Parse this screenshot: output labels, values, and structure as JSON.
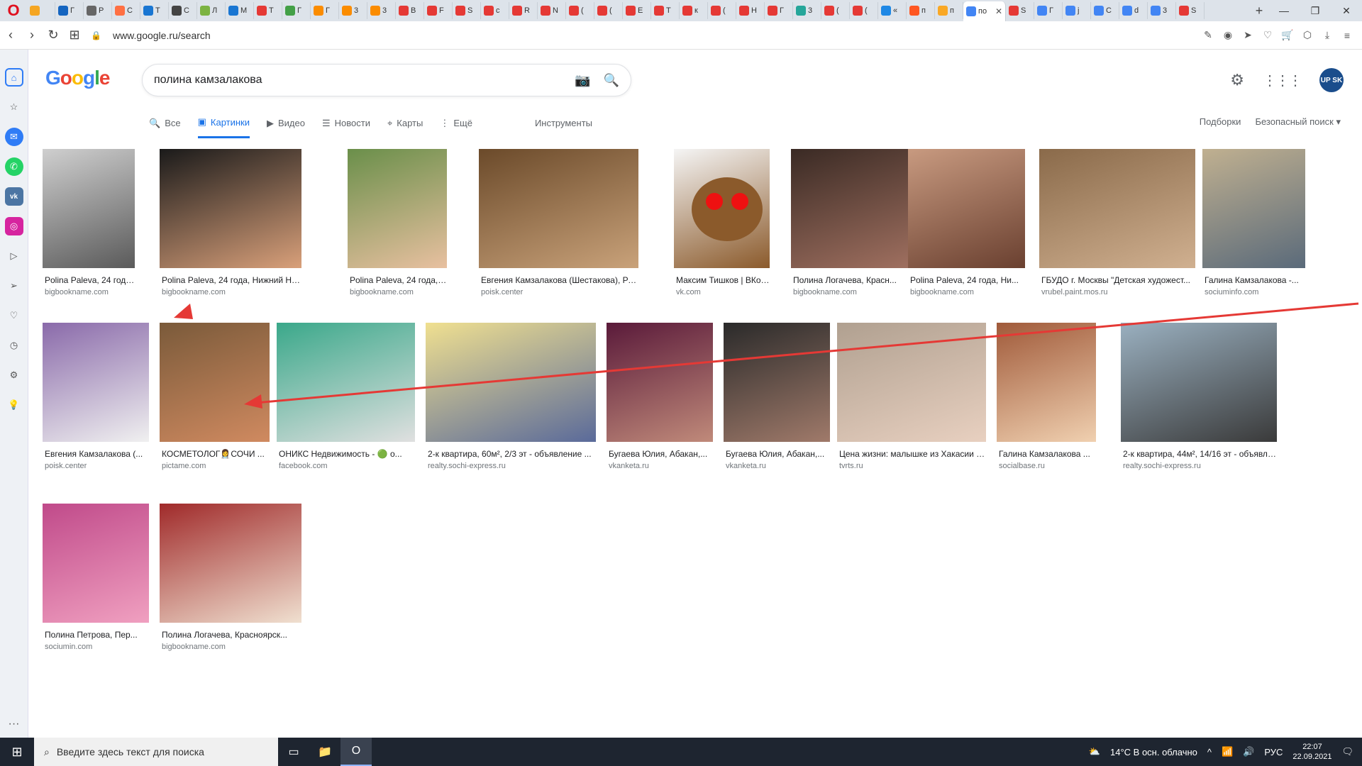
{
  "browser": {
    "opera_logo": "O",
    "tabs": [
      {
        "label": "",
        "color": "#f5a623"
      },
      {
        "label": "Г",
        "color": "#1565c0"
      },
      {
        "label": "Р",
        "color": "#666666"
      },
      {
        "label": "С",
        "color": "#ff7043"
      },
      {
        "label": "Т",
        "color": "#1976d2"
      },
      {
        "label": "С",
        "color": "#444444"
      },
      {
        "label": "Л",
        "color": "#7cb342"
      },
      {
        "label": "М",
        "color": "#1976d2"
      },
      {
        "label": "Т",
        "color": "#e53935"
      },
      {
        "label": "Г",
        "color": "#43a047"
      },
      {
        "label": "Г",
        "color": "#fb8c00"
      },
      {
        "label": "3",
        "color": "#fb8c00"
      },
      {
        "label": "3",
        "color": "#fb8c00"
      },
      {
        "label": "В",
        "color": "#e53935"
      },
      {
        "label": "F",
        "color": "#e53935"
      },
      {
        "label": "S",
        "color": "#e53935"
      },
      {
        "label": "с",
        "color": "#e53935"
      },
      {
        "label": "R",
        "color": "#e53935"
      },
      {
        "label": "N",
        "color": "#e53935"
      },
      {
        "label": "(",
        "color": "#e53935"
      },
      {
        "label": "(",
        "color": "#e53935"
      },
      {
        "label": "Е",
        "color": "#e53935"
      },
      {
        "label": "Т",
        "color": "#e53935"
      },
      {
        "label": "к",
        "color": "#e53935"
      },
      {
        "label": "(",
        "color": "#e53935"
      },
      {
        "label": "Н",
        "color": "#e53935"
      },
      {
        "label": "Г",
        "color": "#e53935"
      },
      {
        "label": "3",
        "color": "#26a69a"
      },
      {
        "label": "(",
        "color": "#e53935"
      },
      {
        "label": "(",
        "color": "#e53935"
      },
      {
        "label": "«",
        "color": "#1e88e5"
      },
      {
        "label": "п",
        "color": "#ff5722"
      },
      {
        "label": "п",
        "color": "#f9a825"
      },
      {
        "label": "по",
        "color": "#4285f4",
        "active": true
      },
      {
        "label": "S",
        "color": "#e53935"
      },
      {
        "label": "Г",
        "color": "#4285f4"
      },
      {
        "label": "j",
        "color": "#4285f4"
      },
      {
        "label": "С",
        "color": "#4285f4"
      },
      {
        "label": "d",
        "color": "#4285f4"
      },
      {
        "label": "3",
        "color": "#4285f4"
      },
      {
        "label": "S",
        "color": "#e53935"
      }
    ],
    "tab_close": "✕",
    "new_tab": "+",
    "url": "www.google.ru/search",
    "win_min": "—",
    "win_max": "❐",
    "win_close": "✕"
  },
  "search": {
    "query": "полина камзалакова",
    "tabs": [
      {
        "label": "Все",
        "icon": "🔍"
      },
      {
        "label": "Картинки",
        "icon": "▣",
        "active": true
      },
      {
        "label": "Видео",
        "icon": "▶"
      },
      {
        "label": "Новости",
        "icon": "☰"
      },
      {
        "label": "Карты",
        "icon": "⌖"
      },
      {
        "label": "Ещё",
        "icon": "⋮"
      }
    ],
    "tools": "Инструменты",
    "collections": "Подборки",
    "safe_search": "Безопасный поиск ▾",
    "avatar_text": "UP SK"
  },
  "results": [
    {
      "caption": "Polina Paleva, 24 года, ...",
      "source": "bigbookname.com",
      "colors": [
        "#cfcfcf",
        "#5a5a5a"
      ]
    },
    {
      "caption": "Polina Paleva, 24 года, Нижний Новго...",
      "source": "bigbookname.com",
      "colors": [
        "#1a1a1a",
        "#d9a07a"
      ]
    },
    {
      "caption": "Polina Paleva, 24 года, ...",
      "source": "bigbookname.com",
      "colors": [
        "#6a8f4a",
        "#e8c0a0"
      ]
    },
    {
      "caption": "Евгения Камзалакова (Шестакова), Россия,...",
      "source": "poisk.center",
      "colors": [
        "#6b4a2a",
        "#c9a27a"
      ]
    },
    {
      "caption": "Максим Тишков | ВКонта...",
      "source": "vk.com",
      "colors": [
        "#f5f5f5",
        "#8b5a2b"
      ]
    },
    {
      "caption": "Полина Логачева, Красн...",
      "source": "bigbookname.com",
      "colors": [
        "#3a2a24",
        "#a07060"
      ]
    },
    {
      "caption": "Polina Paleva, 24 года, Ни...",
      "source": "bigbookname.com",
      "colors": [
        "#c89a80",
        "#6a4030"
      ]
    },
    {
      "caption": "ГБУДО г. Москвы \"Детская художест...",
      "source": "vrubel.paint.mos.ru",
      "colors": [
        "#8a6a4a",
        "#d0b090"
      ]
    },
    {
      "caption": "Галина Камзалакова -...",
      "source": "sociuminfo.com",
      "colors": [
        "#c0b090",
        "#5a6a7a"
      ]
    },
    {
      "caption": "Евгения Камзалакова (...",
      "source": "poisk.center",
      "colors": [
        "#8a6aaa",
        "#f0f0f0"
      ]
    },
    {
      "caption": "КОСМЕТОЛОГ👩‍⚕️СОЧИ ...",
      "source": "pictame.com",
      "colors": [
        "#7a5a3a",
        "#d08a60"
      ]
    },
    {
      "caption": "ОНИКС Недвижимость - 🟢 о...",
      "source": "facebook.com",
      "colors": [
        "#3aa88a",
        "#e0e0e0"
      ]
    },
    {
      "caption": "2-к квартира, 60м², 2/3 эт - объявление ...",
      "source": "realty.sochi-express.ru",
      "colors": [
        "#f0e090",
        "#5a6a9a"
      ]
    },
    {
      "caption": "Бугаева Юлия, Абакан,...",
      "source": "vkanketa.ru",
      "colors": [
        "#5a1a3a",
        "#c08a7a"
      ]
    },
    {
      "caption": "Бугаева Юлия, Абакан,...",
      "source": "vkanketa.ru",
      "colors": [
        "#2a2a2a",
        "#a07a6a"
      ]
    },
    {
      "caption": "Цена жизни: малышке из Хакасии ну...",
      "source": "tvrts.ru",
      "colors": [
        "#b0a090",
        "#e8d0c0"
      ]
    },
    {
      "caption": "Галина Камзалакова ...",
      "source": "socialbase.ru",
      "colors": [
        "#a05a3a",
        "#f0d0b0"
      ]
    },
    {
      "caption": "2-к квартира, 44м², 14/16 эт - объявле...",
      "source": "realty.sochi-express.ru",
      "colors": [
        "#9ab0c0",
        "#3a3a3a"
      ]
    },
    {
      "caption": "Полина Петрова, Пер...",
      "source": "sociumin.com",
      "colors": [
        "#c04a8a",
        "#f0a0c0"
      ]
    },
    {
      "caption": "Полина Логачева, Красноярск...",
      "source": "bigbookname.com",
      "colors": [
        "#a02a2a",
        "#f0e0d0"
      ]
    }
  ],
  "taskbar": {
    "start": "⊞",
    "search_placeholder": "Введите здесь текст для поиска",
    "weather": "14°C  В осн. облачно",
    "lang": "РУС",
    "time": "22:07",
    "date": "22.09.2021"
  },
  "annotation_color": "#e53935"
}
